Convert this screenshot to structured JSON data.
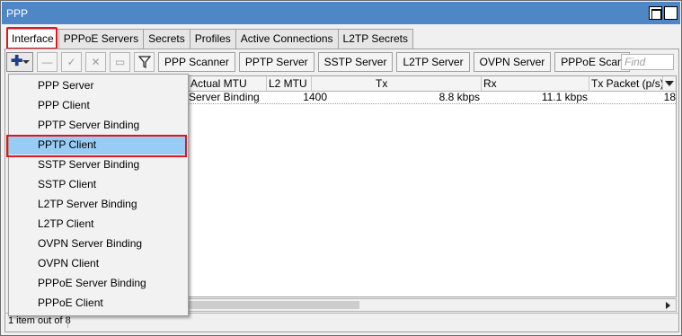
{
  "window": {
    "title": "PPP"
  },
  "tabs": [
    {
      "label": "Interface"
    },
    {
      "label": "PPPoE Servers"
    },
    {
      "label": "Secrets"
    },
    {
      "label": "Profiles"
    },
    {
      "label": "Active Connections"
    },
    {
      "label": "L2TP Secrets"
    }
  ],
  "toolbar": {
    "buttons": [
      {
        "label": "PPP Scanner"
      },
      {
        "label": "PPTP Server"
      },
      {
        "label": "SSTP Server"
      },
      {
        "label": "L2TP Server"
      },
      {
        "label": "OVPN Server"
      },
      {
        "label": "PPPoE Scan"
      }
    ],
    "find_placeholder": "Find",
    "icons": [
      "add-icon",
      "remove-icon",
      "enable-icon",
      "disable-icon",
      "comment-icon",
      "filter-icon"
    ]
  },
  "table": {
    "columns": [
      "Actual MTU",
      "L2 MTU",
      "Tx",
      "Rx",
      "Tx Packet (p/s)"
    ],
    "rows": [
      {
        "type_partial": "Server Binding",
        "actual_mtu": "1400",
        "l2_mtu": "",
        "tx": "8.8 kbps",
        "rx": "11.1 kbps",
        "tx_packet": "18"
      }
    ]
  },
  "status": {
    "text": "1 item out of 8"
  },
  "add_menu": {
    "items": [
      {
        "label": "PPP Server"
      },
      {
        "label": "PPP Client"
      },
      {
        "label": "PPTP Server Binding"
      },
      {
        "label": "PPTP Client"
      },
      {
        "label": "SSTP Server Binding"
      },
      {
        "label": "SSTP Client"
      },
      {
        "label": "L2TP Server Binding"
      },
      {
        "label": "L2TP Client"
      },
      {
        "label": "OVPN Server Binding"
      },
      {
        "label": "OVPN Client"
      },
      {
        "label": "PPPoE Server Binding"
      },
      {
        "label": "PPPoE Client"
      }
    ],
    "selected": "PPTP Client"
  },
  "colors": {
    "titlebar": "#4f86c6",
    "selection": "#99ccf5",
    "highlight_box": "#e0141e"
  }
}
